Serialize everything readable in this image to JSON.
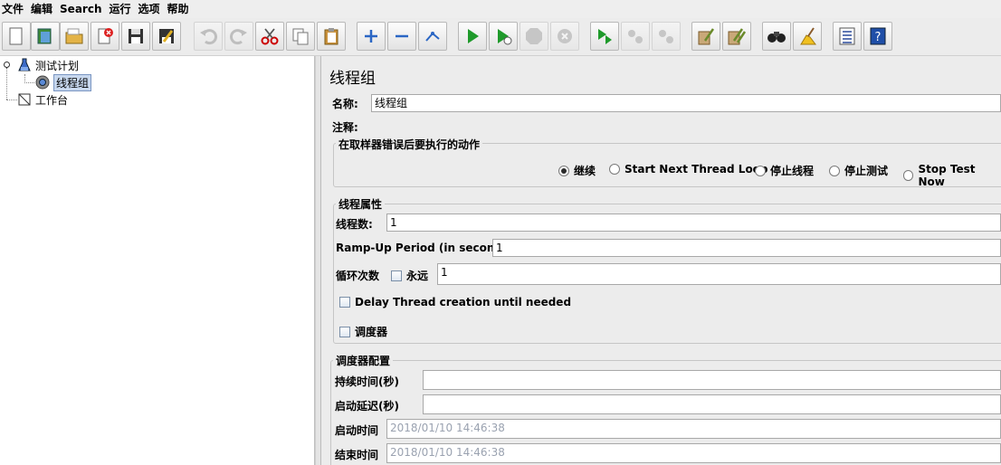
{
  "menu": [
    "文件",
    "编辑",
    "Search",
    "运行",
    "选项",
    "帮助"
  ],
  "toolbar": {
    "icons": [
      "new-icon",
      "templates-icon",
      "open-icon",
      "close-icon",
      "save-icon",
      "save-as-icon",
      "undo-icon",
      "redo-icon",
      "cut-icon",
      "copy-icon",
      "paste-icon",
      "expand-icon",
      "collapse-icon",
      "toggle-icon",
      "start-icon",
      "start-no-pause-icon",
      "stop-icon",
      "shutdown-icon",
      "remote-start-icon",
      "remote-stop-icon",
      "remote-exit-icon",
      "clear-icon",
      "clear-all-icon",
      "search-icon",
      "reset-search-icon",
      "function-helper-icon",
      "help-icon"
    ]
  },
  "tree": {
    "plan": "测试计划",
    "thread_group": "线程组",
    "workbench": "工作台"
  },
  "panel": {
    "title": "线程组",
    "name_label": "名称:",
    "name_value": "线程组",
    "comment_label": "注释:",
    "comment_value": "",
    "on_error": {
      "title": "在取样器错误后要执行的动作",
      "options": [
        "继续",
        "Start Next Thread Loop",
        "停止线程",
        "停止测试",
        "Stop Test Now"
      ],
      "selected": "继续"
    },
    "thread_props": {
      "title": "线程属性",
      "threads_label": "线程数:",
      "threads_value": "1",
      "rampup_label": "Ramp-Up Period (in seconds):",
      "rampup_value": "1",
      "loop_label": "循环次数",
      "forever_label": "永远",
      "loop_value": "1",
      "delay_label": "Delay Thread creation until needed",
      "scheduler_label": "调度器"
    },
    "scheduler": {
      "title": "调度器配置",
      "duration_label": "持续时间(秒)",
      "duration_value": "",
      "delay_label": "启动延迟(秒)",
      "delay_value": "",
      "start_label": "启动时间",
      "start_value": "2018/01/10 14:46:38",
      "end_label": "结束时间",
      "end_value": "2018/01/10 14:46:38"
    }
  }
}
